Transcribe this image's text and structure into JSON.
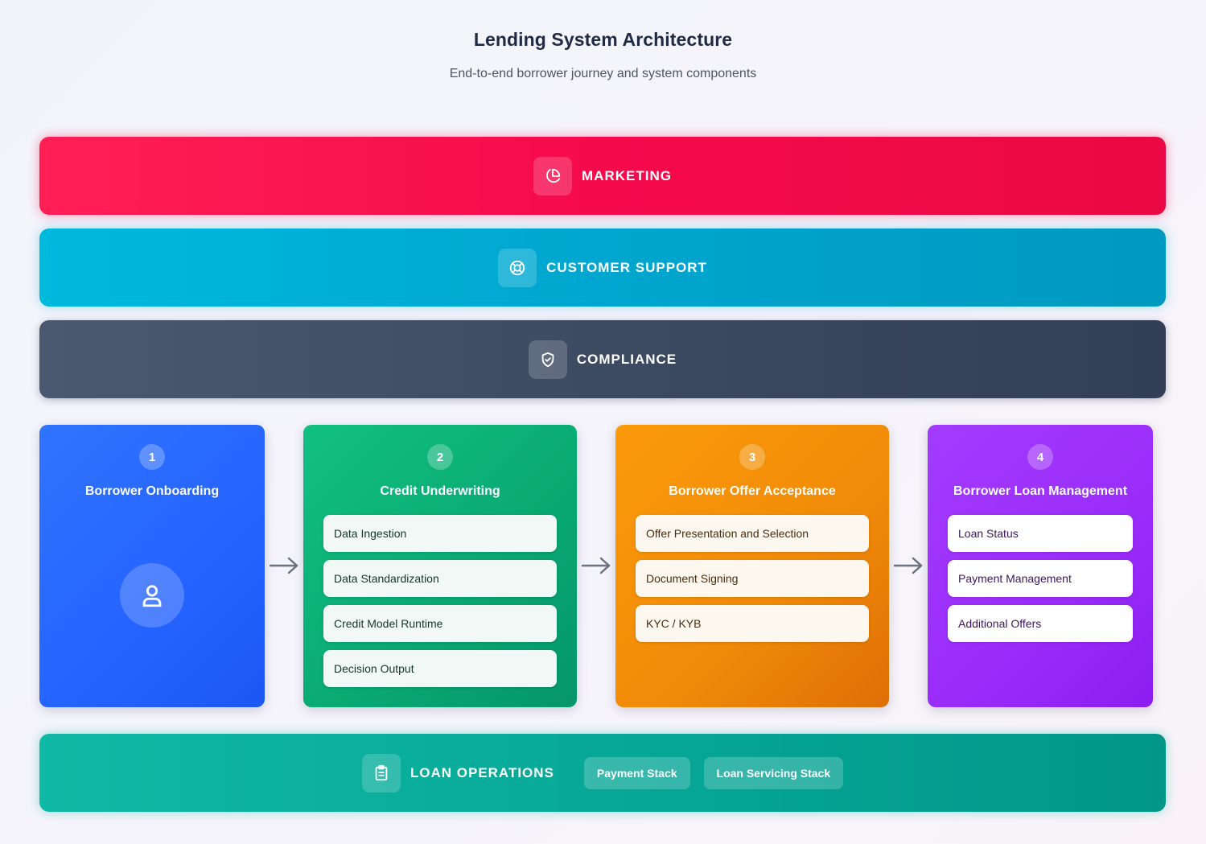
{
  "header": {
    "title": "Lending System Architecture",
    "subtitle": "End-to-end borrower journey and system components"
  },
  "bands": {
    "marketing": {
      "label": "MARKETING",
      "icon": "pie-chart-icon"
    },
    "customer_support": {
      "label": "CUSTOMER SUPPORT",
      "icon": "lifebuoy-icon"
    },
    "compliance": {
      "label": "COMPLIANCE",
      "icon": "shield-check-icon"
    },
    "loan_operations": {
      "label": "LOAN OPERATIONS",
      "icon": "clipboard-icon",
      "chips": [
        "Payment Stack",
        "Loan Servicing Stack"
      ]
    }
  },
  "stages": [
    {
      "number": "1",
      "title": "Borrower Onboarding",
      "icon": "user-icon",
      "items": []
    },
    {
      "number": "2",
      "title": "Credit Underwriting",
      "items": [
        "Data Ingestion",
        "Data Standardization",
        "Credit Model Runtime",
        "Decision Output"
      ]
    },
    {
      "number": "3",
      "title": "Borrower Offer Acceptance",
      "items": [
        "Offer Presentation and Selection",
        "Document Signing",
        "KYC / KYB"
      ]
    },
    {
      "number": "4",
      "title": "Borrower Loan Management",
      "items": [
        "Loan Status",
        "Payment Management",
        "Additional Offers"
      ]
    }
  ],
  "colors": {
    "marketing": "#f50a4c",
    "customer_support": "#00a6cf",
    "compliance": "#3c4a62",
    "loan_operations": "#07a898",
    "stage_1": "#2563ff",
    "stage_2": "#09a872",
    "stage_3": "#f08a08",
    "stage_4": "#9a2cfa",
    "arrow": "#6b7280"
  }
}
